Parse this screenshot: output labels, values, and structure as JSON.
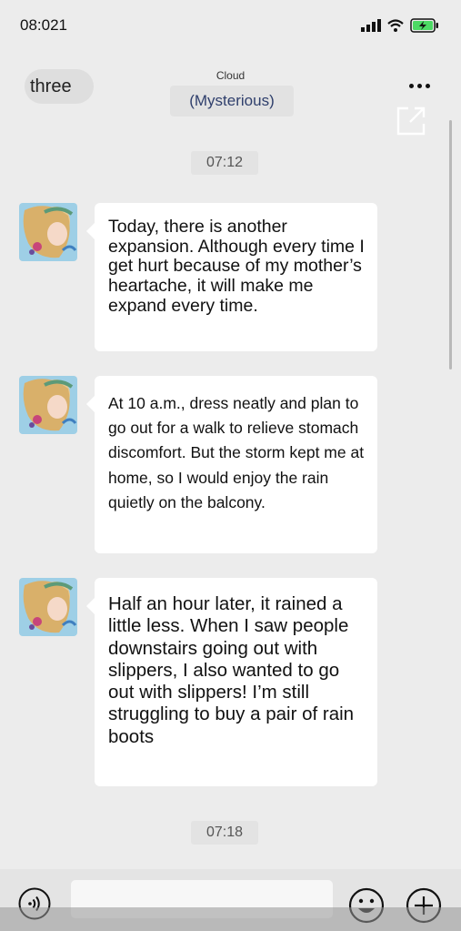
{
  "status_bar": {
    "time": "08:021",
    "signal_icon": "signal-bars-icon",
    "wifi_icon": "wifi-icon",
    "battery_icon": "battery-charging-icon",
    "battery_color": "#4cd964"
  },
  "nav": {
    "back_label": "three",
    "subtitle": "Cloud",
    "title": "(Mysterious)",
    "more_icon": "more-dots-icon",
    "share_icon": "share-icon",
    "title_color": "#2f3f6c"
  },
  "messages": [
    {
      "type": "time",
      "text": "07:12"
    },
    {
      "type": "received",
      "avatar": "avatar-illustration",
      "text": "Today, there is another expansion. Although every time I get hurt because of my mother’s heartache, it will make me expand every time."
    },
    {
      "type": "received",
      "avatar": "avatar-illustration",
      "text": "At 10 a.m., dress neatly and plan to go out for a walk to relieve stomach discomfort. But the storm kept me at home, so I would enjoy the rain quietly on the balcony."
    },
    {
      "type": "received",
      "avatar": "avatar-illustration",
      "text": "Half an hour later, it rained a little less. When I saw people downstairs going out with slippers, I also wanted to go out with slippers! I’m still struggling to buy a pair of rain boots"
    },
    {
      "type": "time",
      "text": "07:18"
    }
  ],
  "input_bar": {
    "voice_icon": "voice-icon",
    "input_value": "",
    "input_placeholder": "",
    "emoji_icon": "emoji-icon",
    "plus_icon": "plus-icon"
  }
}
